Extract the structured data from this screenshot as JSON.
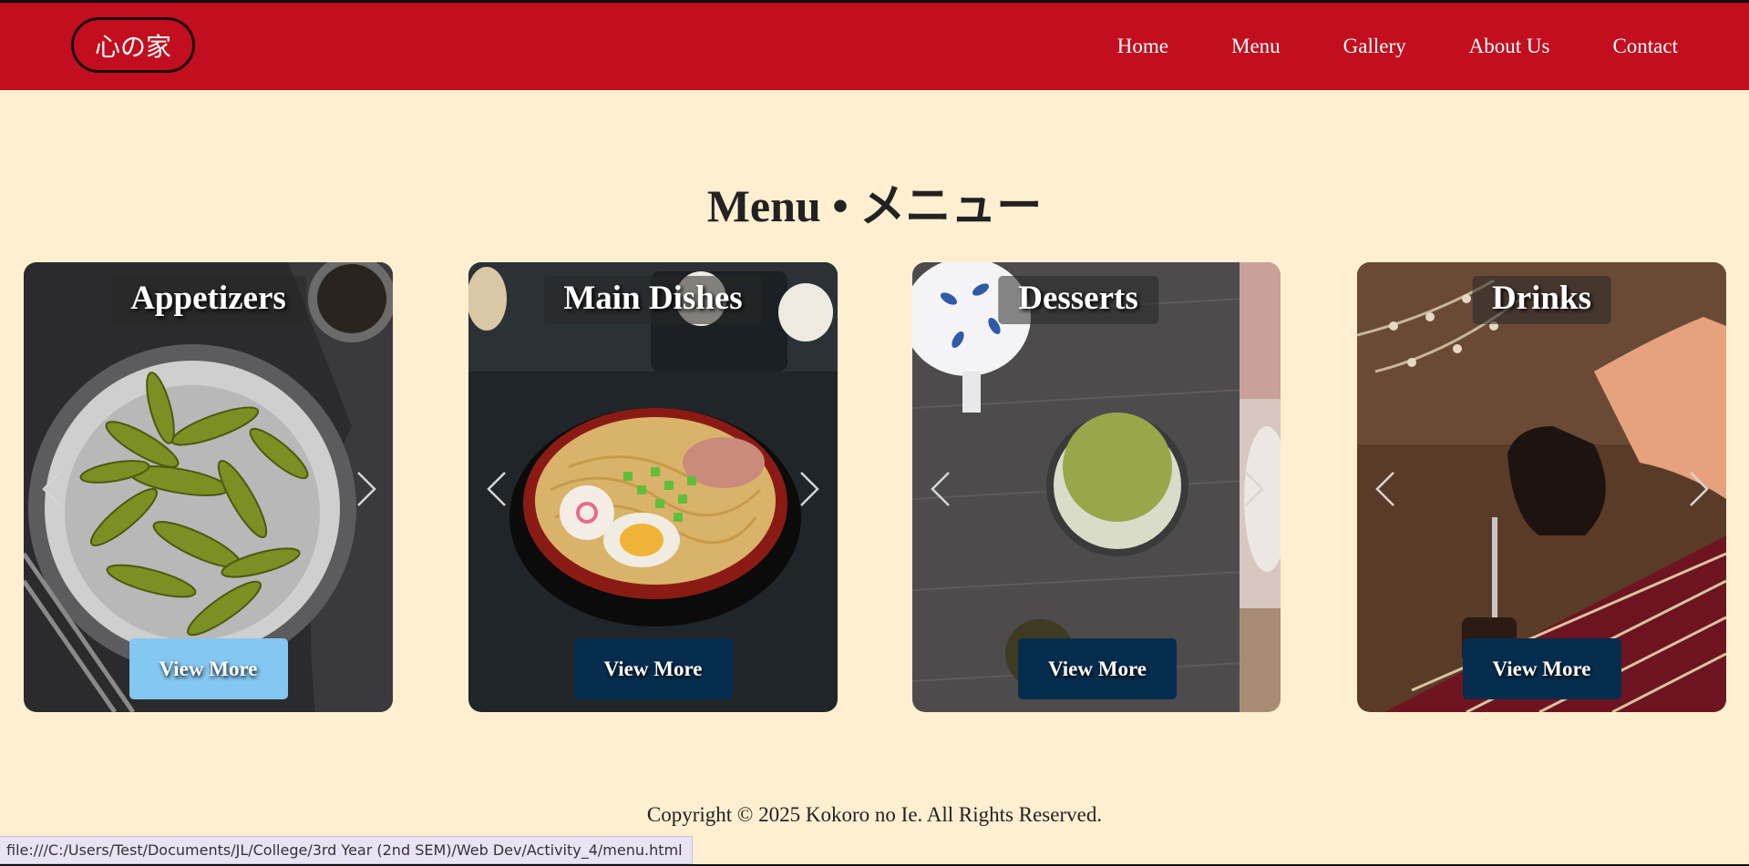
{
  "header": {
    "logo": "心の家",
    "nav": [
      "Home",
      "Menu",
      "Gallery",
      "About Us",
      "Contact"
    ]
  },
  "page_title": "Menu • メニュー",
  "cards": [
    {
      "title": "Appetizers",
      "button": "View More"
    },
    {
      "title": "Main Dishes",
      "button": "View More"
    },
    {
      "title": "Desserts",
      "button": "View More"
    },
    {
      "title": "Drinks",
      "button": "View More"
    }
  ],
  "footer": "Copyright © 2025 Kokoro no Ie. All Rights Reserved.",
  "status_bar": "file:///C:/Users/Test/Documents/JL/College/3rd Year (2nd SEM)/Web Dev/Activity_4/menu.html",
  "icons": {
    "prev": "chevron-left-icon",
    "next": "chevron-right-icon"
  },
  "colors": {
    "header": "#C20E1F",
    "background": "#FFEFD1",
    "button": "#062D4E",
    "button_hover": "#84C7F0"
  }
}
